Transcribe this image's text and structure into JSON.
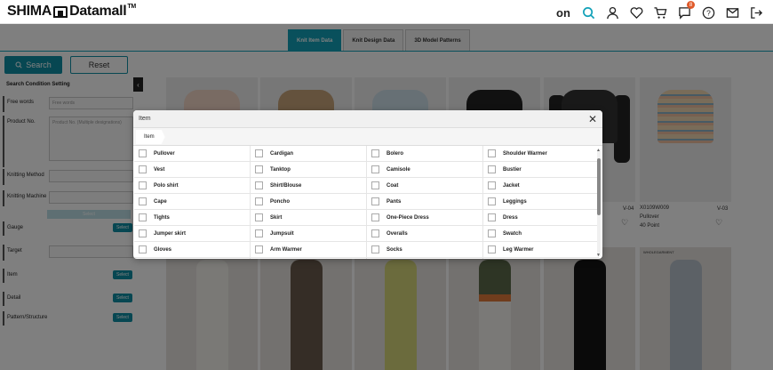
{
  "header": {
    "logo_text": "SHIMA",
    "logo_text2": "Datamall",
    "logo_tm": "TM",
    "on_label": "on",
    "notification_count": "8",
    "icons": [
      "search-icon",
      "user-icon",
      "heart-icon",
      "cart-icon",
      "chat-icon",
      "help-icon",
      "mail-icon",
      "logout-icon"
    ]
  },
  "tabs": [
    {
      "label": "Knit Item Data",
      "active": true
    },
    {
      "label": "Knit Design Data",
      "active": false
    },
    {
      "label": "3D Model Patterns",
      "active": false
    }
  ],
  "actions": {
    "search": "Search",
    "reset": "Reset"
  },
  "sidebar": {
    "title": "Search Condition Setting",
    "free_words": {
      "label": "Free words",
      "placeholder": "Free words"
    },
    "product_no": {
      "label": "Product No.",
      "placeholder": "Product No. (Multiple designations)"
    },
    "knitting_method": {
      "label": "Knitting Method"
    },
    "knitting_machine": {
      "label": "Knitting Machine"
    },
    "select_small": "Select",
    "gauge": {
      "label": "Gauge",
      "button": "Select"
    },
    "target": {
      "label": "Target"
    },
    "item": {
      "label": "Item",
      "button": "Select"
    },
    "detail": {
      "label": "Detail",
      "button": "Select"
    },
    "pattern": {
      "label": "Pattern/Structure",
      "button": "Select"
    }
  },
  "products": [
    {
      "code": "V-04"
    },
    {
      "code": "X0109W009",
      "gauge_text": "40 Point",
      "type_text": "Pullover",
      "code2": "V-03"
    }
  ],
  "product_label": "WHOLEGARMENT",
  "modal": {
    "title": "Item",
    "breadcrumb": "Item",
    "columns": [
      [
        "Pullover",
        "Vest",
        "Polo shirt",
        "Cape",
        "Tights",
        "Jumper skirt",
        "Gloves"
      ],
      [
        "Cardigan",
        "Tanktop",
        "Shirt/Blouse",
        "Poncho",
        "Skirt",
        "Jumpsuit",
        "Arm Warmer"
      ],
      [
        "Bolero",
        "Camisole",
        "Coat",
        "Pants",
        "One-Piece Dress",
        "Overalls",
        "Socks"
      ],
      [
        "Shoulder Warmer",
        "Bustier",
        "Jacket",
        "Leggings",
        "Dress",
        "Swatch",
        "Leg Warmer"
      ]
    ]
  },
  "colors": {
    "accent": "#0e8fa5",
    "tab_active": "#12a1b8",
    "badge": "#e05a2a"
  }
}
